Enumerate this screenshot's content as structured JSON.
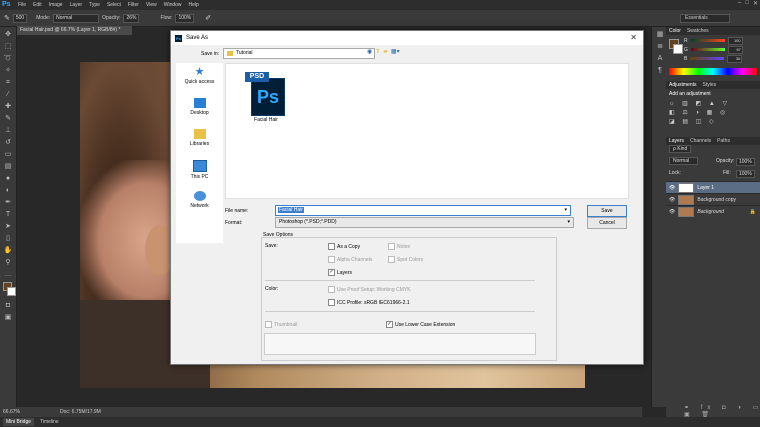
{
  "app": {
    "logo": "Ps",
    "menu": [
      "File",
      "Edit",
      "Image",
      "Layer",
      "Type",
      "Select",
      "Filter",
      "View",
      "Window",
      "Help"
    ],
    "window_controls": [
      "–",
      "□",
      "✕"
    ]
  },
  "options_bar": {
    "size_value": "500",
    "mode_label": "Mode:",
    "mode_value": "Normal",
    "opacity_label": "Opacity:",
    "opacity_value": "26%",
    "flow_label": "Flow:",
    "flow_value": "100%",
    "workspace": "Essentials"
  },
  "document": {
    "tab_title": "Facial Hair.psd @ 66.7% (Layer 1, RGB/8#) *",
    "zoom": "66.67%",
    "doc_info": "Doc: 6.75M/17.9M"
  },
  "bottom_tabs": [
    "Mini Bridge",
    "Timeline"
  ],
  "panels": {
    "color_tabs": [
      "Color",
      "Swatches"
    ],
    "color_values": [
      {
        "channel": "R",
        "value": "100"
      },
      {
        "channel": "G",
        "value": "67"
      },
      {
        "channel": "B",
        "value": "36"
      }
    ],
    "adjust_tabs": [
      "Adjustments",
      "Styles"
    ],
    "adjust_title": "Add an adjustment",
    "layers_tabs": [
      "Layers",
      "Channels",
      "Paths"
    ],
    "kind_label": "ρ Kind",
    "blend_mode": "Normal",
    "opacity_label": "Opacity:",
    "opacity_value": "100%",
    "lock_label": "Lock:",
    "fill_label": "Fill:",
    "fill_value": "100%",
    "layers": [
      {
        "name": "Layer 1",
        "selected": true
      },
      {
        "name": "Background copy",
        "selected": false
      },
      {
        "name": "Background",
        "selected": false
      }
    ]
  },
  "dialog": {
    "title": "Save As",
    "save_in_label": "Save in:",
    "save_in_value": "Tutorial",
    "places": [
      "Quick access",
      "Desktop",
      "Libraries",
      "This PC",
      "Network"
    ],
    "file": {
      "tag": "PSD",
      "icon_text": "Ps",
      "name": "Facial Hair"
    },
    "file_name_label": "File name:",
    "file_name_value": "Facial Hair",
    "format_label": "Format:",
    "format_value": "Photoshop (*.PSD;*.PDD)",
    "save_button": "Save",
    "cancel_button": "Cancel",
    "save_options_label": "Save Options",
    "save_label": "Save:",
    "as_copy": "As a Copy",
    "notes": "Notes",
    "alpha_channels": "Alpha Channels",
    "spot_colors": "Spot Colors",
    "layers": "Layers",
    "color_label": "Color:",
    "use_proof": "Use Proof Setup:  Working CMYK",
    "icc_profile": "ICC Profile:  sRGB IEC61966-2.1",
    "thumbnail": "Thumbnail",
    "lowercase_ext": "Use Lower Case Extension"
  }
}
